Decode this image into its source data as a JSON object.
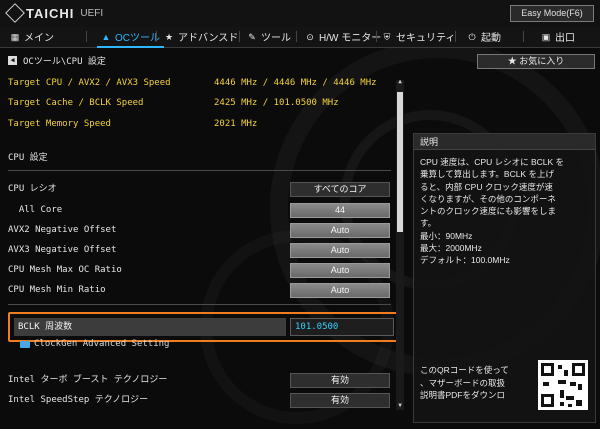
{
  "header": {
    "brand": "TAICHI",
    "brand_sub": "UEFI",
    "easy_mode_label": "Easy Mode(F6)"
  },
  "nav": {
    "items": [
      {
        "label": "メイン",
        "icon": "grid-icon"
      },
      {
        "label": "OCツール",
        "icon": "flame-icon",
        "active": true
      },
      {
        "label": "アドバンスド",
        "icon": "star-icon"
      },
      {
        "label": "ツール",
        "icon": "wrench-icon"
      },
      {
        "label": "H/W モニター",
        "icon": "monitor-icon"
      },
      {
        "label": "セキュリティ",
        "icon": "shield-icon"
      },
      {
        "label": "起動",
        "icon": "power-icon"
      },
      {
        "label": "出口",
        "icon": "exit-icon"
      }
    ],
    "accent_color": "#2fb6ff"
  },
  "breadcrumb": "OCツール\\CPU 設定",
  "favorites_label": "お気に入り",
  "info_rows": [
    {
      "label": "Target CPU   / AVX2 / AVX3 Speed",
      "value": "4446 MHz / 4446 MHz / 4446 MHz"
    },
    {
      "label": "Target Cache / BCLK Speed",
      "value": "2425 MHz / 101.0500 MHz"
    },
    {
      "label": "Target Memory Speed",
      "value": "2021 MHz"
    }
  ],
  "section_title": "CPU 設定",
  "settings": [
    {
      "label": "CPU レシオ",
      "value": "すべてのコア"
    },
    {
      "label": "  All Core",
      "value": "44"
    },
    {
      "label": "AVX2 Negative Offset",
      "value": "Auto"
    },
    {
      "label": "AVX3 Negative Offset",
      "value": "Auto"
    },
    {
      "label": "CPU Mesh Max OC Ratio",
      "value": "Auto"
    },
    {
      "label": "CPU Mesh Min Ratio",
      "value": "Auto"
    }
  ],
  "bclk": {
    "label": "BCLK 周波数",
    "value": "101.0500"
  },
  "folder_label": "ClockGen Advanced Setting",
  "bottom_settings": [
    {
      "label": "Intel ターボ ブースト テクノロジー",
      "value": "有効"
    },
    {
      "label": "Intel SpeedStep テクノロジー",
      "value": "有効"
    }
  ],
  "description": {
    "title": "説明",
    "lines": [
      "CPU 速度は、CPU レシオに BCLK を",
      "乗算して算出します。BCLK を上げ",
      "ると、内部 CPU クロック速度が速",
      "くなりますが、その他のコンポーネ",
      "ントのクロック速度にも影響をしま",
      "す。",
      "最小：90MHz",
      "最大：2000MHz",
      "デフォルト：100.0MHz"
    ],
    "qr_lines": [
      "このQRコードを使って",
      "、マザーボードの取扱",
      "説明書PDFをダウンロ"
    ]
  },
  "colors": {
    "highlight": "#f2d13a",
    "selection_border": "#f07d20",
    "value_text": "#33d0ff"
  }
}
